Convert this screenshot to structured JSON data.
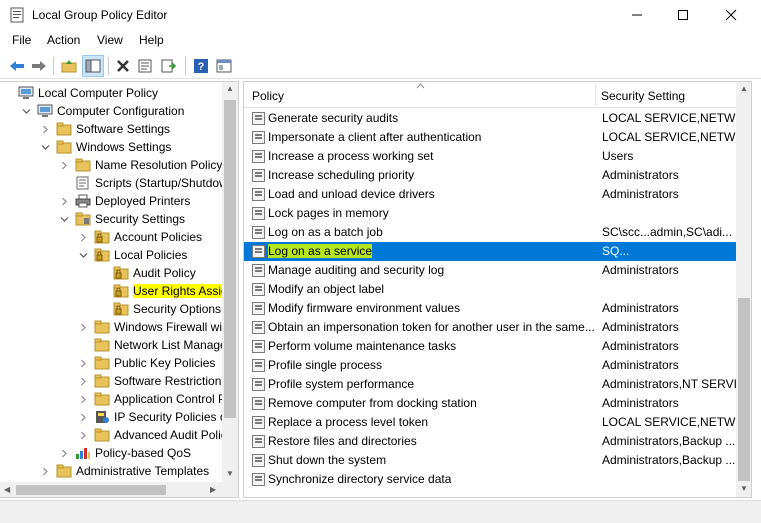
{
  "window": {
    "title": "Local Group Policy Editor"
  },
  "menu": [
    "File",
    "Action",
    "View",
    "Help"
  ],
  "toolbar": [
    "back-icon",
    "forward-icon",
    "up-folder-icon",
    "show-hide-tree-icon",
    "delete-icon",
    "properties-icon",
    "export-list-icon",
    "help-icon",
    "console-icon"
  ],
  "tree": [
    {
      "label": "Local Computer Policy",
      "level": 0,
      "expander": "none",
      "icon": "computer-icon",
      "selected": false
    },
    {
      "label": "Computer Configuration",
      "level": 1,
      "expander": "expanded",
      "icon": "computer-icon",
      "selected": false
    },
    {
      "label": "Software Settings",
      "level": 2,
      "expander": "collapsed",
      "icon": "folder-icon",
      "selected": false
    },
    {
      "label": "Windows Settings",
      "level": 2,
      "expander": "expanded",
      "icon": "folder-icon",
      "selected": false
    },
    {
      "label": "Name Resolution Policy",
      "level": 3,
      "expander": "collapsed",
      "icon": "folder-icon",
      "selected": false
    },
    {
      "label": "Scripts (Startup/Shutdown)",
      "level": 3,
      "expander": "none",
      "icon": "scripts-icon",
      "selected": false
    },
    {
      "label": "Deployed Printers",
      "level": 3,
      "expander": "collapsed",
      "icon": "printer-icon",
      "selected": false
    },
    {
      "label": "Security Settings",
      "level": 3,
      "expander": "expanded",
      "icon": "security-icon",
      "selected": false
    },
    {
      "label": "Account Policies",
      "level": 4,
      "expander": "collapsed",
      "icon": "lock-folder-icon",
      "selected": false
    },
    {
      "label": "Local Policies",
      "level": 4,
      "expander": "expanded",
      "icon": "lock-folder-icon",
      "selected": false
    },
    {
      "label": "Audit Policy",
      "level": 5,
      "expander": "none",
      "icon": "lock-folder-icon",
      "selected": false
    },
    {
      "label": "User Rights Assignment",
      "level": 5,
      "expander": "none",
      "icon": "lock-folder-icon",
      "selected": true
    },
    {
      "label": "Security Options",
      "level": 5,
      "expander": "none",
      "icon": "lock-folder-icon",
      "selected": false
    },
    {
      "label": "Windows Firewall with Advanced Security",
      "level": 4,
      "expander": "collapsed",
      "icon": "folder-icon",
      "selected": false
    },
    {
      "label": "Network List Manager Policies",
      "level": 4,
      "expander": "none",
      "icon": "folder-icon",
      "selected": false
    },
    {
      "label": "Public Key Policies",
      "level": 4,
      "expander": "collapsed",
      "icon": "folder-icon",
      "selected": false
    },
    {
      "label": "Software Restriction Policies",
      "level": 4,
      "expander": "collapsed",
      "icon": "folder-icon",
      "selected": false
    },
    {
      "label": "Application Control Policies",
      "level": 4,
      "expander": "collapsed",
      "icon": "folder-icon",
      "selected": false
    },
    {
      "label": "IP Security Policies on Local Computer",
      "level": 4,
      "expander": "collapsed",
      "icon": "ipsec-icon",
      "selected": false
    },
    {
      "label": "Advanced Audit Policy Configuration",
      "level": 4,
      "expander": "collapsed",
      "icon": "folder-icon",
      "selected": false
    },
    {
      "label": "Policy-based QoS",
      "level": 3,
      "expander": "collapsed",
      "icon": "qos-icon",
      "selected": false
    },
    {
      "label": "Administrative Templates",
      "level": 2,
      "expander": "collapsed",
      "icon": "folder-icon",
      "selected": false
    }
  ],
  "list": {
    "headers": {
      "policy": "Policy",
      "setting": "Security Setting"
    },
    "rows": [
      {
        "policy": "Generate security audits",
        "setting": "LOCAL SERVICE,NETWO...",
        "selected": false
      },
      {
        "policy": "Impersonate a client after authentication",
        "setting": "LOCAL SERVICE,NETWO...",
        "selected": false
      },
      {
        "policy": "Increase a process working set",
        "setting": "Users",
        "selected": false
      },
      {
        "policy": "Increase scheduling priority",
        "setting": "Administrators",
        "selected": false
      },
      {
        "policy": "Load and unload device drivers",
        "setting": "Administrators",
        "selected": false
      },
      {
        "policy": "Lock pages in memory",
        "setting": "",
        "selected": false
      },
      {
        "policy": "Log on as a batch job",
        "setting": "SC\\scc...admin,SC\\adi...",
        "selected": false
      },
      {
        "policy": "Log on as a service",
        "setting": "SQ...",
        "selected": true
      },
      {
        "policy": "Manage auditing and security log",
        "setting": "Administrators",
        "selected": false
      },
      {
        "policy": "Modify an object label",
        "setting": "",
        "selected": false
      },
      {
        "policy": "Modify firmware environment values",
        "setting": "Administrators",
        "selected": false
      },
      {
        "policy": "Obtain an impersonation token for another user in the same...",
        "setting": "Administrators",
        "selected": false
      },
      {
        "policy": "Perform volume maintenance tasks",
        "setting": "Administrators",
        "selected": false
      },
      {
        "policy": "Profile single process",
        "setting": "Administrators",
        "selected": false
      },
      {
        "policy": "Profile system performance",
        "setting": "Administrators,NT SERVI...",
        "selected": false
      },
      {
        "policy": "Remove computer from docking station",
        "setting": "Administrators",
        "selected": false
      },
      {
        "policy": "Replace a process level token",
        "setting": "LOCAL SERVICE,NETWO...",
        "selected": false
      },
      {
        "policy": "Restore files and directories",
        "setting": "Administrators,Backup ...",
        "selected": false
      },
      {
        "policy": "Shut down the system",
        "setting": "Administrators,Backup ...",
        "selected": false
      },
      {
        "policy": "Synchronize directory service data",
        "setting": "",
        "selected": false
      }
    ]
  },
  "colors": {
    "selection": "#0078d7",
    "highlight_yellow": "#ffff00",
    "highlight_green": "#b5e61d"
  }
}
